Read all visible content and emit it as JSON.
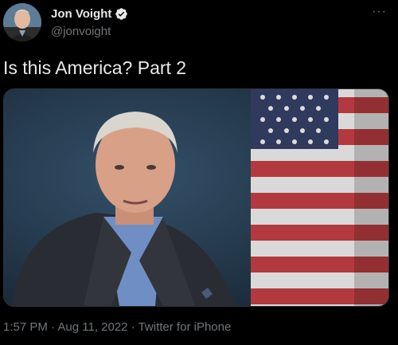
{
  "author": {
    "name": "Jon Voight",
    "handle": "@jonvoight",
    "verified_icon": "verified-badge-icon"
  },
  "tweet": {
    "text": "Is this America? Part 2"
  },
  "media": {
    "type": "video-thumbnail",
    "description_icon": "video-still"
  },
  "meta": {
    "time": "1:57 PM",
    "separator": " · ",
    "date": "Aug 11, 2022",
    "source": "Twitter for iPhone"
  },
  "colors": {
    "background": "#000000",
    "text_primary": "#e7e9ea",
    "text_secondary": "#71767b",
    "verified": "#1d9bf0"
  },
  "more_icon": "more-options-icon"
}
